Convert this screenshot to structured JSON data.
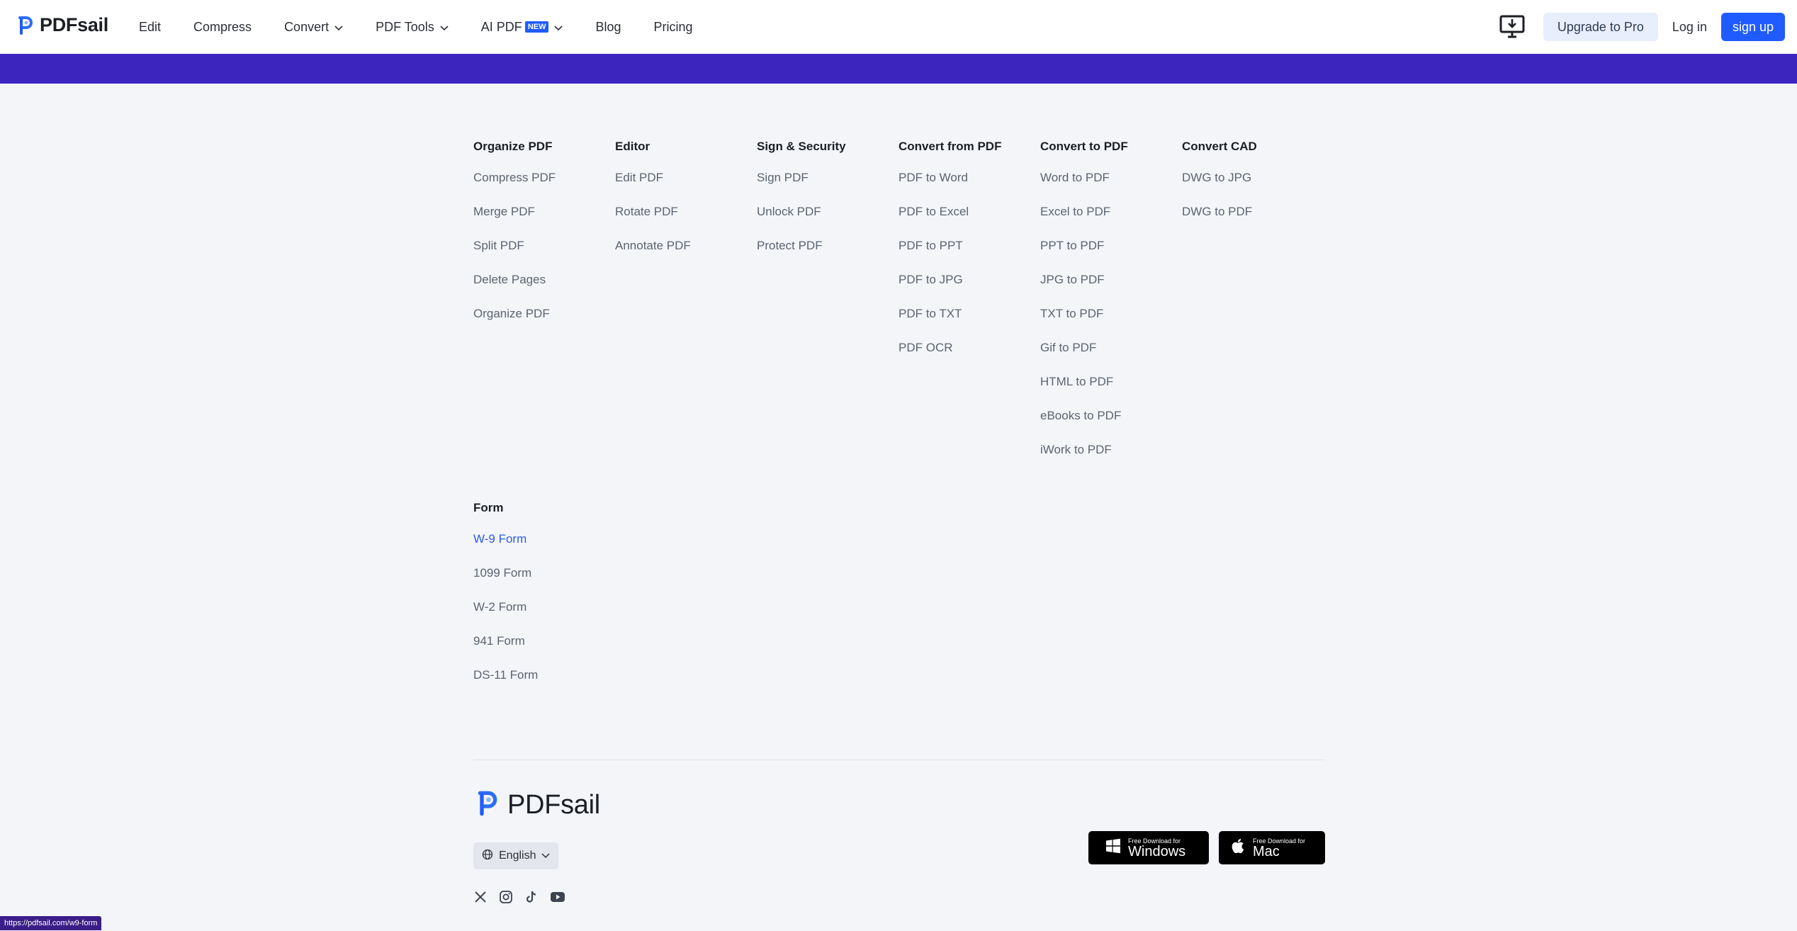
{
  "header": {
    "brand": "PDFsail",
    "nav": [
      {
        "label": "Edit"
      },
      {
        "label": "Compress"
      },
      {
        "label": "Convert"
      },
      {
        "label": "PDF Tools"
      },
      {
        "label": "AI PDF",
        "badge": "NEW"
      },
      {
        "label": "Blog"
      },
      {
        "label": "Pricing"
      }
    ],
    "upgrade_label": "Upgrade to Pro",
    "login_label": "Log in",
    "signup_label": "sign up"
  },
  "colors": {
    "accent": "#1f5bff",
    "band": "#3b25be",
    "active_link": "#2d5be3",
    "background": "#f3f5f9"
  },
  "footer": {
    "columns": [
      {
        "title": "Organize PDF",
        "links": [
          "Compress PDF",
          "Merge PDF",
          "Split PDF",
          "Delete Pages",
          "Organize PDF"
        ]
      },
      {
        "title": "Editor",
        "links": [
          "Edit PDF",
          "Rotate PDF",
          "Annotate PDF"
        ]
      },
      {
        "title": "Sign & Security",
        "links": [
          "Sign PDF",
          "Unlock PDF",
          "Protect PDF"
        ]
      },
      {
        "title": "Convert from PDF",
        "links": [
          "PDF to Word",
          "PDF to Excel",
          "PDF to PPT",
          "PDF to JPG",
          "PDF to TXT",
          "PDF OCR"
        ]
      },
      {
        "title": "Convert to PDF",
        "links": [
          "Word to PDF",
          "Excel to PDF",
          "PPT to PDF",
          "JPG to PDF",
          "TXT to PDF",
          "Gif to PDF",
          "HTML to PDF",
          "eBooks to PDF",
          "iWork to PDF"
        ]
      },
      {
        "title": "Convert CAD",
        "links": [
          "DWG to JPG",
          "DWG to PDF"
        ]
      }
    ],
    "form": {
      "title": "Form",
      "links": [
        "W-9 Form",
        "1099 Form",
        "W-2 Form",
        "941 Form",
        "DS-11 Form"
      ]
    },
    "brand": "PDFsail",
    "language": "English",
    "downloads": {
      "windows": {
        "small": "Free Download for",
        "big": "Windows"
      },
      "mac": {
        "small": "Free Download for",
        "big": "Mac"
      }
    },
    "socials": [
      "x-icon",
      "instagram-icon",
      "tiktok-icon",
      "youtube-icon"
    ]
  },
  "status_url": "https://pdfsail.com/w9-form"
}
